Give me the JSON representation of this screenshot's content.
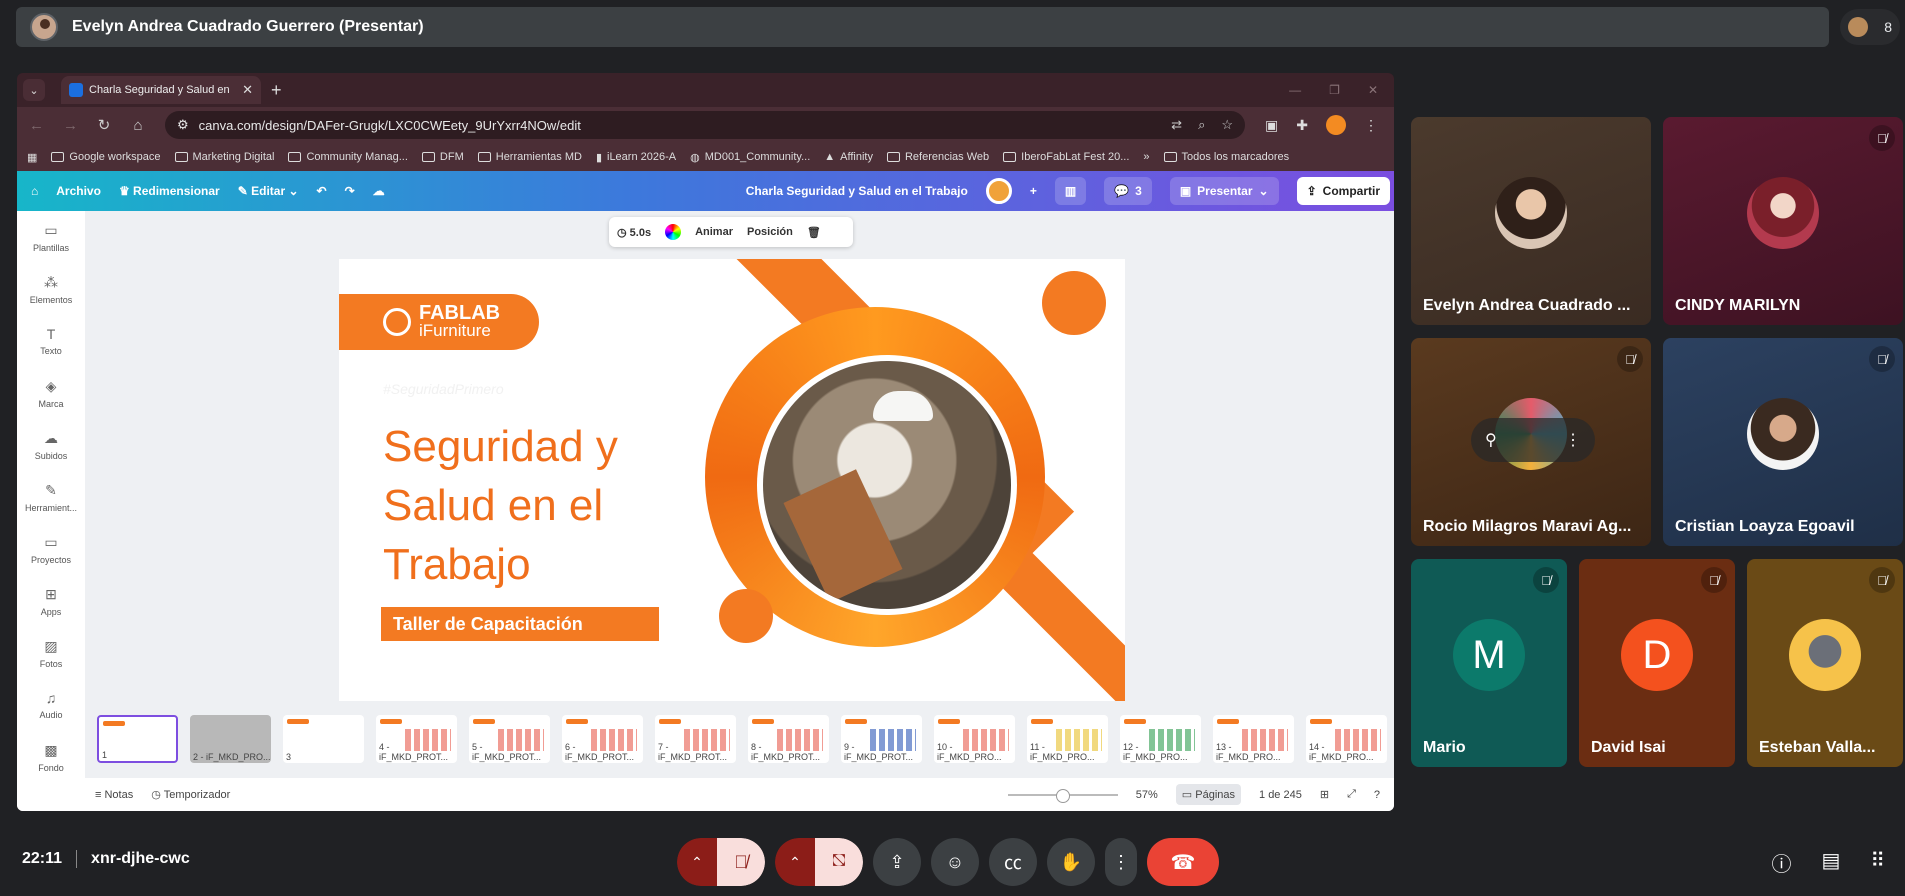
{
  "presenter": {
    "name": "Evelyn Andrea Cuadrado Guerrero (Presentar)"
  },
  "participants_count": "8",
  "browser": {
    "tab_title": "Charla Seguridad y Salud en",
    "url": "canva.com/design/DAFer-Grugk/LXC0CWEety_9UrYxrr4NOw/edit",
    "bookmarks": [
      "Google workspace",
      "Marketing Digital",
      "Community Manag...",
      "DFM",
      "Herramientas MD",
      "iLearn 2026-A",
      "MD001_Community...",
      "Affinity",
      "Referencias Web",
      "IberoFabLat Fest 20..."
    ],
    "bookmarks_all": "Todos los marcadores"
  },
  "canva": {
    "menu": {
      "archivo": "Archivo",
      "redimensionar": "Redimensionar",
      "editar": "Editar"
    },
    "design_title": "Charla Seguridad y Salud en el Trabajo",
    "comments_badge": "3",
    "presentar": "Presentar",
    "compartir": "Compartir",
    "sidebar": [
      "Plantillas",
      "Elementos",
      "Texto",
      "Marca",
      "Subidos",
      "Herramient...",
      "Proyectos",
      "Apps",
      "Fotos",
      "Audio",
      "Fondo"
    ],
    "floatbar": {
      "duration": "5.0s",
      "animar": "Animar",
      "posicion": "Posición"
    },
    "slide": {
      "brand": "FABLAB",
      "brand_sub": "iFurniture",
      "hashtag": "#SeguridadPrimero",
      "title": "Seguridad y Salud en el Trabajo",
      "subtitle": "Taller de Capacitación"
    },
    "pages": [
      "1",
      "2 - iF_MKD_PRO...",
      "3",
      "4 - iF_MKD_PROT...",
      "5 - iF_MKD_PROT...",
      "6 - iF_MKD_PROT...",
      "7 - iF_MKD_PROT...",
      "8 - iF_MKD_PROT...",
      "9 - iF_MKD_PROT...",
      "10 - iF_MKD_PRO...",
      "11 - iF_MKD_PRO...",
      "12 - iF_MKD_PRO...",
      "13 - iF_MKD_PRO...",
      "14 - iF_MKD_PRO..."
    ],
    "bottom": {
      "notas": "Notas",
      "temporizador": "Temporizador",
      "zoom": "57%",
      "paginas": "Páginas",
      "page_count": "1 de 245"
    }
  },
  "tiles": [
    {
      "name": "Evelyn Andrea Cuadrado ...",
      "muted": false
    },
    {
      "name": "CINDY MARILYN",
      "muted": true
    },
    {
      "name": "Rocio Milagros Maravi Ag...",
      "muted": true
    },
    {
      "name": "Cristian Loayza Egoavil",
      "muted": true
    },
    {
      "name": "Mario",
      "initial": "M",
      "muted": true
    },
    {
      "name": "David Isai",
      "initial": "D",
      "muted": true
    },
    {
      "name": "Esteban Valla...",
      "muted": true
    }
  ],
  "meeting": {
    "time": "22:11",
    "code": "xnr-djhe-cwc"
  }
}
